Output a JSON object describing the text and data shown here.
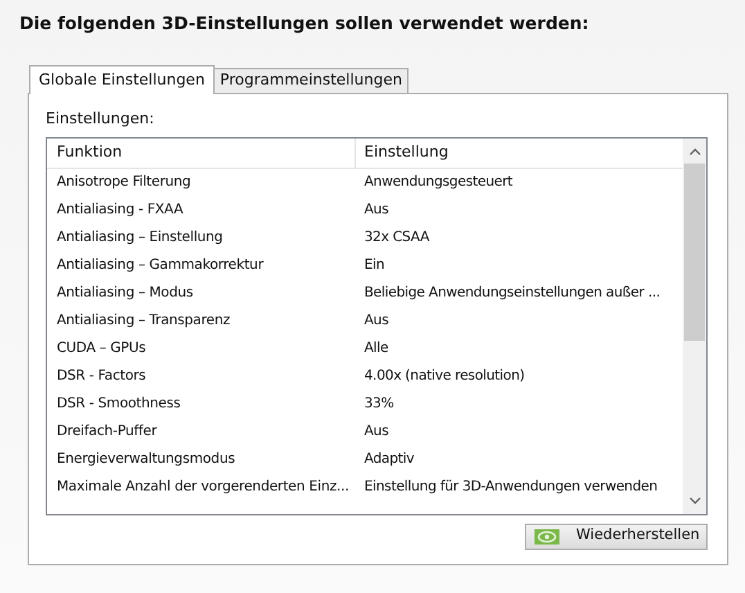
{
  "heading": "Die folgenden 3D-Einstellungen sollen verwendet werden:",
  "tabs": [
    {
      "label": "Globale Einstellungen",
      "selected": true
    },
    {
      "label": "Programmeinstellungen",
      "selected": false
    }
  ],
  "settings_label": "Einstellungen:",
  "table": {
    "columns": [
      "Funktion",
      "Einstellung"
    ],
    "rows": [
      [
        "Anisotrope Filterung",
        "Anwendungsgesteuert"
      ],
      [
        "Antialiasing - FXAA",
        "Aus"
      ],
      [
        "Antialiasing – Einstellung",
        "32x CSAA"
      ],
      [
        "Antialiasing – Gammakorrektur",
        "Ein"
      ],
      [
        "Antialiasing – Modus",
        "Beliebige Anwendungseinstellungen außer ..."
      ],
      [
        "Antialiasing – Transparenz",
        "Aus"
      ],
      [
        "CUDA – GPUs",
        "Alle"
      ],
      [
        "DSR - Factors",
        "4.00x (native resolution)"
      ],
      [
        "DSR - Smoothness",
        "33%"
      ],
      [
        "Dreifach-Puffer",
        "Aus"
      ],
      [
        "Energieverwaltungsmodus",
        "Adaptiv"
      ],
      [
        "Maximale Anzahl der vorgerenderten Einz...",
        "Einstellung für 3D-Anwendungen verwenden"
      ]
    ]
  },
  "restore_button": "Wiederherstellen"
}
